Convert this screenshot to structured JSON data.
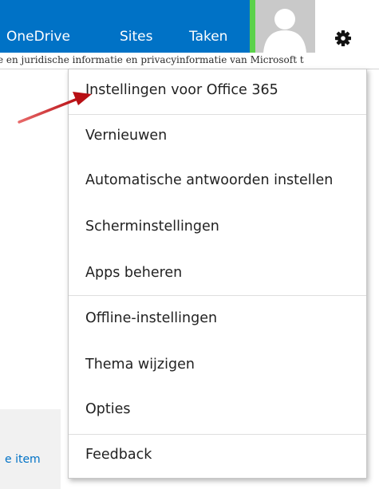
{
  "topnav": {
    "items": [
      {
        "label": "OneDrive"
      },
      {
        "label": "Sites"
      },
      {
        "label": "Taken"
      }
    ],
    "avatar_icon": "user-avatar-icon",
    "settings_icon": "gear-icon",
    "brand_color": "#0072c6",
    "accent_color": "#5bd24a"
  },
  "legal_bar": {
    "text": "e en juridische informatie en privacyinformatie van Microsoft t"
  },
  "background": {
    "link_fragment": "e item"
  },
  "settings_menu": {
    "items": [
      {
        "label": "Instellingen voor Office 365"
      },
      {
        "label": "Vernieuwen"
      },
      {
        "label": "Automatische antwoorden instellen"
      },
      {
        "label": "Scherminstellingen"
      },
      {
        "label": "Apps beheren"
      },
      {
        "label": "Offline-instellingen"
      },
      {
        "label": "Thema wijzigen"
      },
      {
        "label": "Opties"
      },
      {
        "label": "Feedback"
      }
    ]
  },
  "annotation": {
    "arrow_color": "#c0181c"
  }
}
